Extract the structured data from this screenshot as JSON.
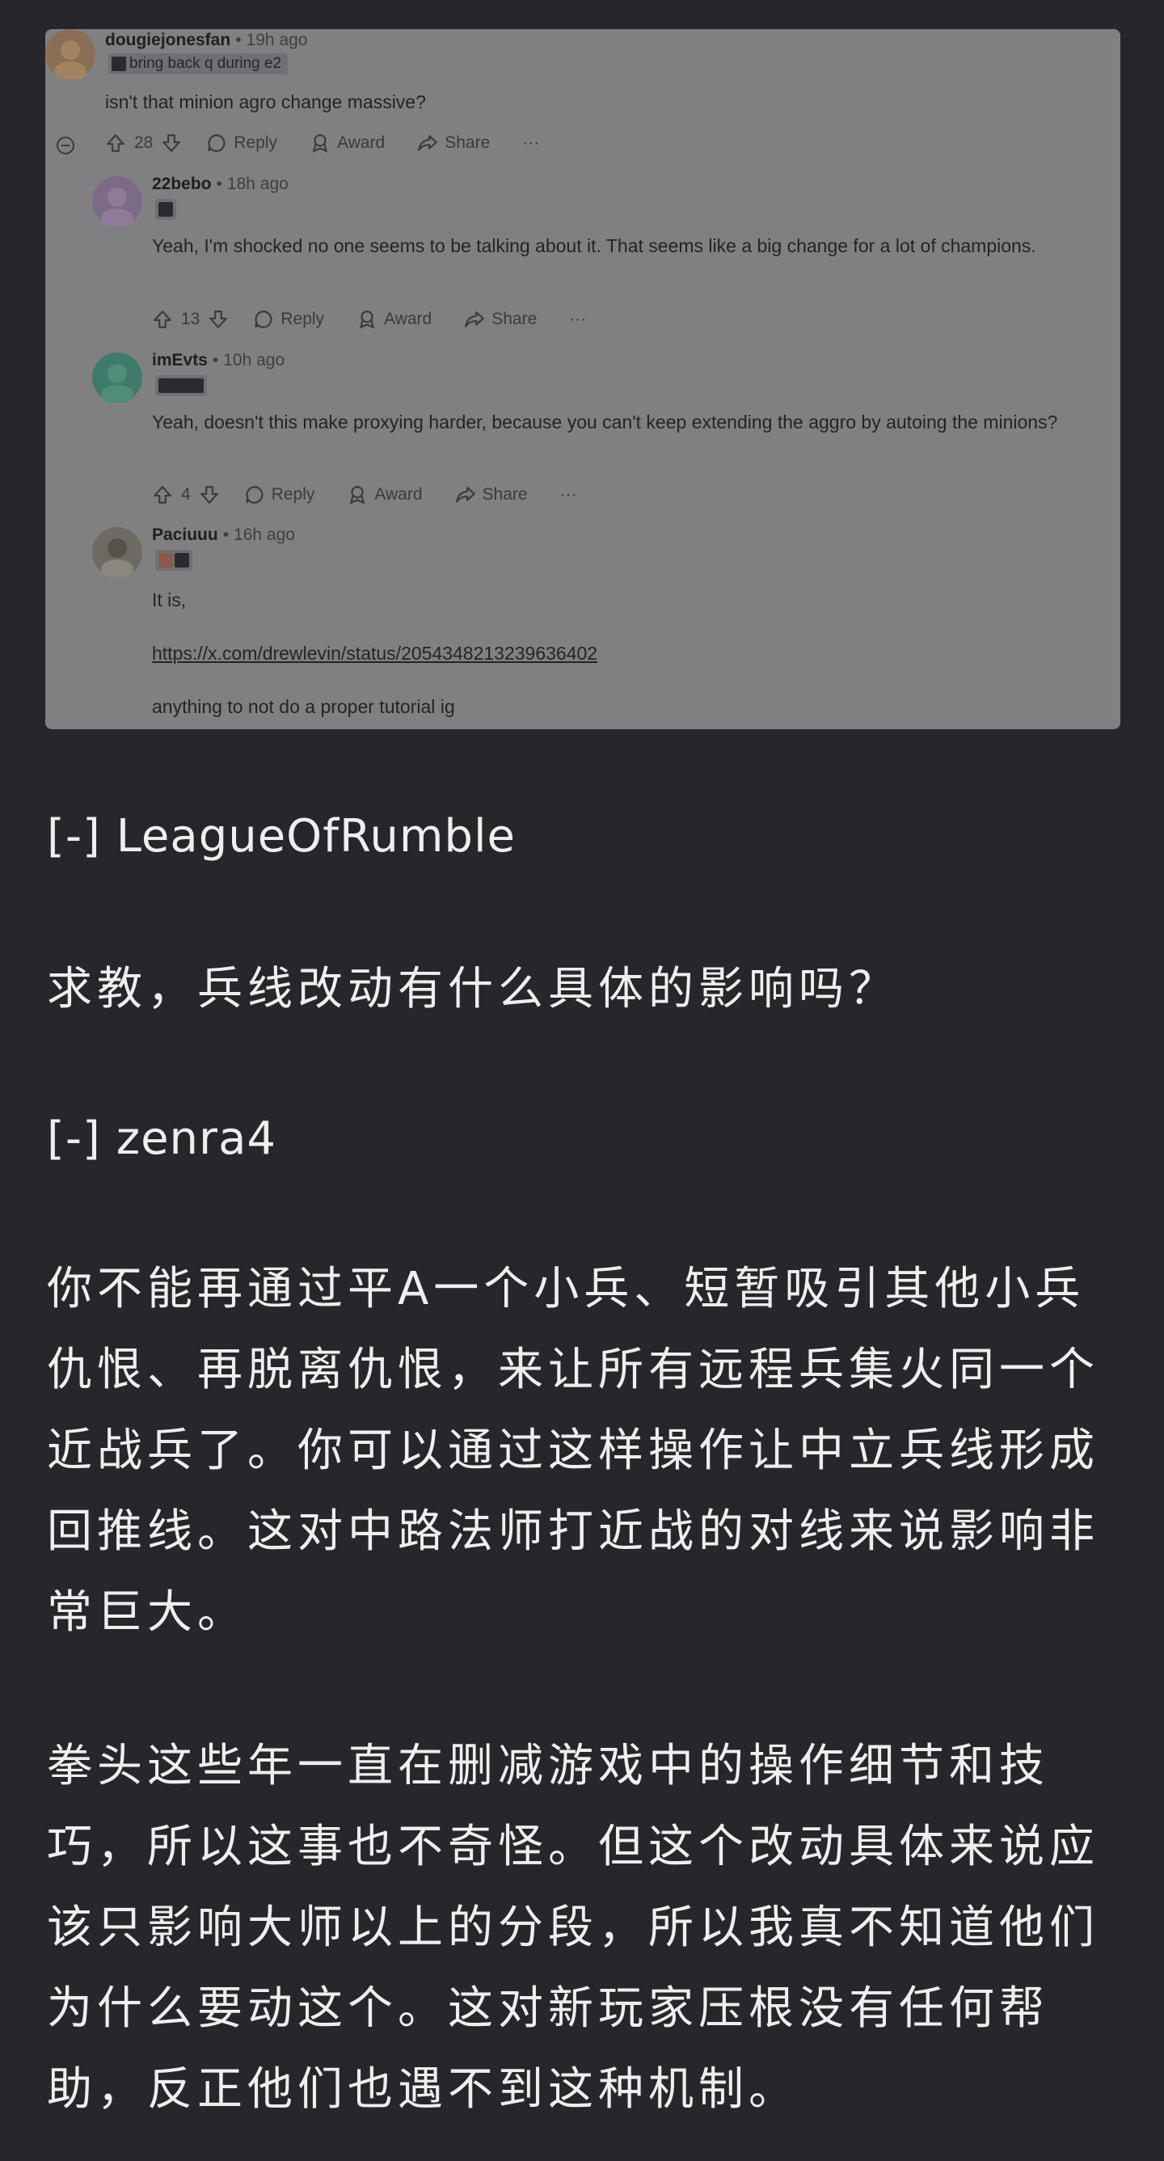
{
  "screenshot": {
    "comments": [
      {
        "username": "dougiejonesfan",
        "time": "19h ago",
        "flair": "bring back q during e2",
        "body": "isn't that minion agro change massive?",
        "votes": "28",
        "actions": {
          "reply": "Reply",
          "award": "Award",
          "share": "Share",
          "more": "···"
        }
      },
      {
        "username": "22bebo",
        "time": "18h ago",
        "flair": "",
        "body": "Yeah, I'm shocked no one seems to be talking about it. That seems like a big change for a lot of champions.",
        "votes": "13",
        "actions": {
          "reply": "Reply",
          "award": "Award",
          "share": "Share",
          "more": "···"
        }
      },
      {
        "username": "imEvts",
        "time": "10h ago",
        "flair": "",
        "body": "Yeah, doesn't this make proxying harder, because you can't keep extending the aggro by autoing the minions?",
        "votes": "4",
        "actions": {
          "reply": "Reply",
          "award": "Award",
          "share": "Share",
          "more": "···"
        }
      },
      {
        "username": "Paciuuu",
        "time": "16h ago",
        "flair": "",
        "body_line1": "It is,",
        "link": "https://x.com/drewlevin/status/2054348213239636402",
        "body_line3": "anything to not do a proper tutorial ig"
      }
    ],
    "separator": "•"
  },
  "thread": {
    "reply1_user": "[-] LeagueOfRumble",
    "reply1_text": "求教，兵线改动有什么具体的影响吗？",
    "reply2_user": "[-] zenra4",
    "reply2_para1": "你不能再通过平A一个小兵、短暂吸引其他小兵仇恨、再脱离仇恨，来让所有远程兵集火同一个近战兵了。你可以通过这样操作让中立兵线形成回推线。这对中路法师打近战的对线来说影响非常巨大。",
    "reply2_para2": "拳头这些年一直在删减游戏中的操作细节和技巧，所以这事也不奇怪。但这个改动具体来说应该只影响大师以上的分段，所以我真不知道他们为什么要动这个。这对新玩家压根没有任何帮助，反正他们也遇不到这种机制。"
  },
  "colors": {
    "page_bg": "#26272b",
    "screenshot_bg": "#808083",
    "text": "#eeeeef"
  }
}
